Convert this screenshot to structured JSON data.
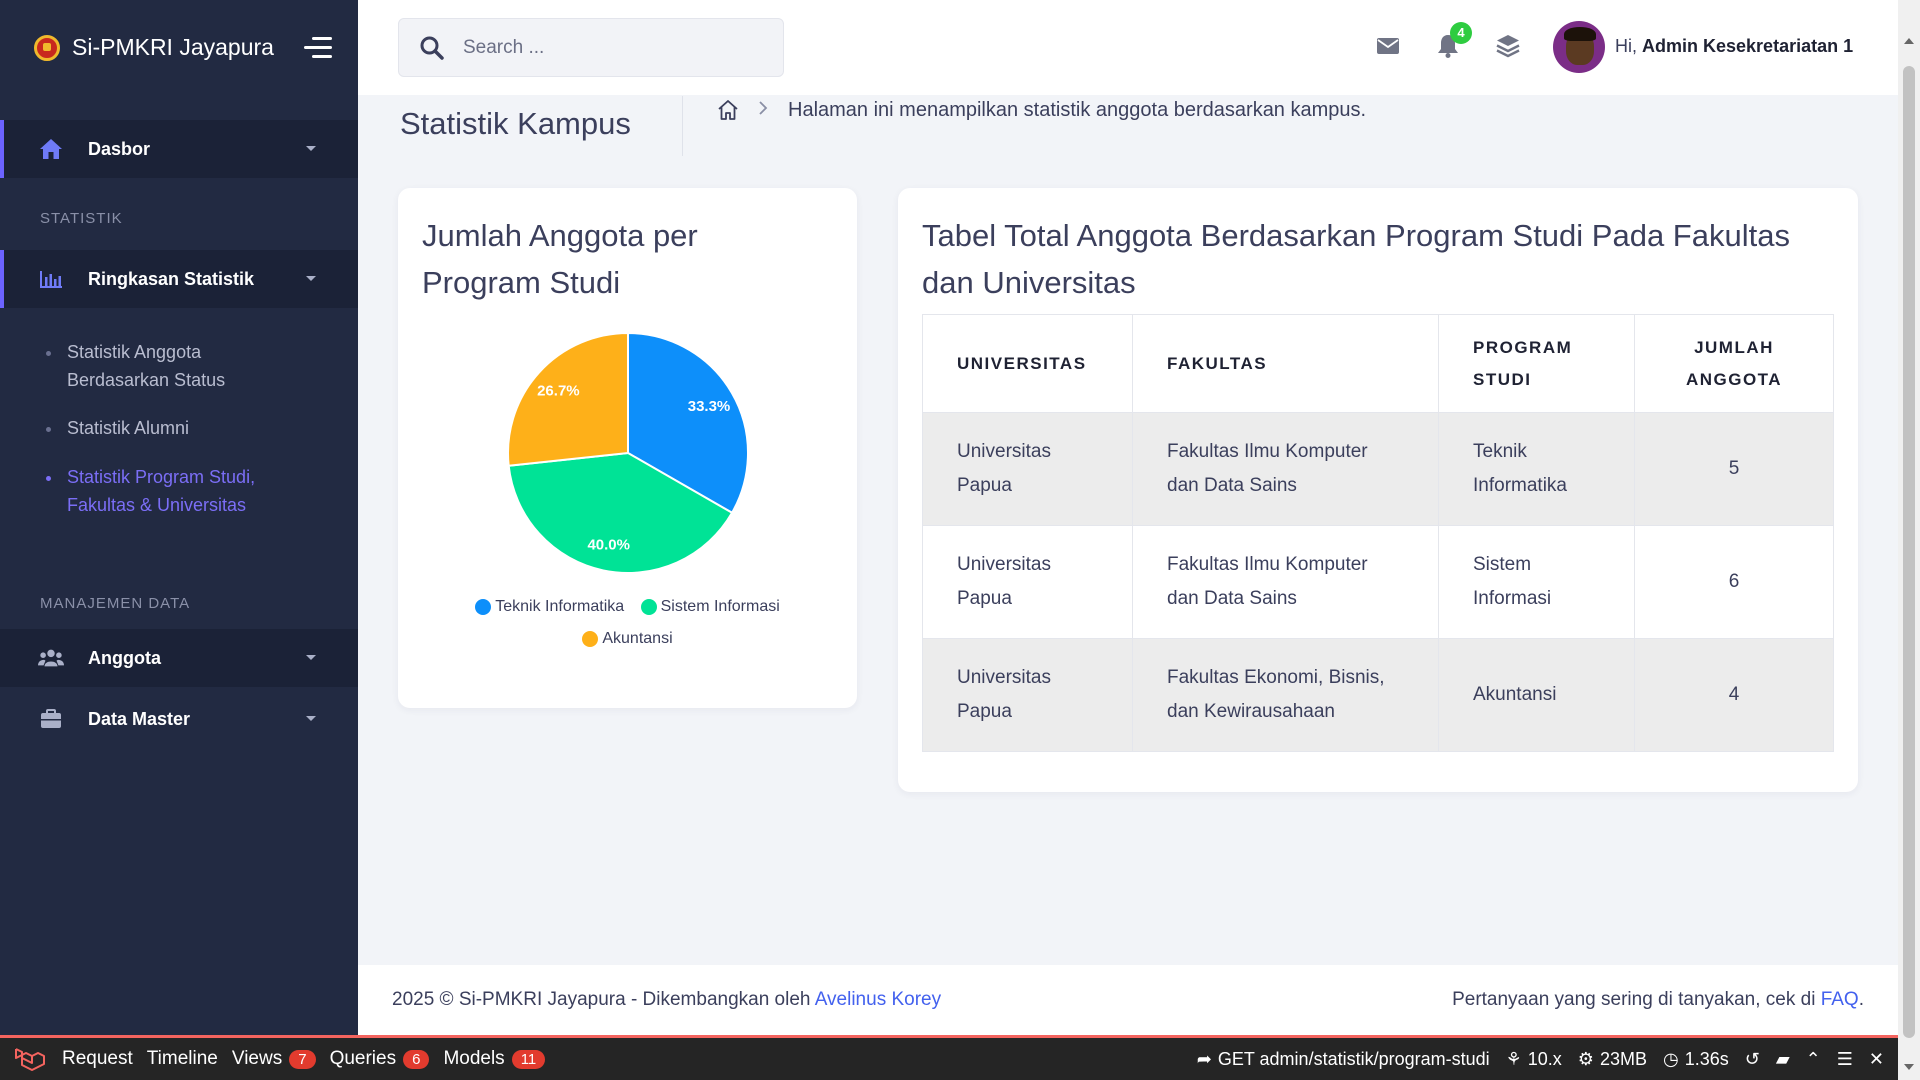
{
  "brand": {
    "name": "Si-PMKRI Jayapura"
  },
  "sidebar": {
    "dashboard": "Dasbor",
    "section_stats": "STATISTIK",
    "stats_menu": "Ringkasan Statistik",
    "sub_items": [
      {
        "label": "Statistik Anggota Berdasarkan Status"
      },
      {
        "label": "Statistik Alumni"
      },
      {
        "label": "Statistik Program Studi, Fakultas & Universitas"
      }
    ],
    "section_data": "MANAJEMEN DATA",
    "members": "Anggota",
    "master": "Data Master"
  },
  "header": {
    "search_placeholder": "Search ...",
    "notification_count": "4",
    "greeting_prefix": "Hi,",
    "user_name": "Admin Kesekretariatan 1"
  },
  "page": {
    "title": "Statistik Kampus",
    "description": "Halaman ini menampilkan statistik anggota berdasarkan kampus."
  },
  "pie_card": {
    "title": "Jumlah Anggota per Program Studi"
  },
  "chart_data": {
    "type": "pie",
    "title": "Jumlah Anggota per Program Studi",
    "categories": [
      "Teknik Informatika",
      "Sistem Informasi",
      "Akuntansi"
    ],
    "values": [
      33.3,
      40.0,
      26.7
    ],
    "labels": [
      "33.3%",
      "40.0%",
      "26.7%"
    ],
    "colors": [
      "#0d8ffa",
      "#00e396",
      "#feb019"
    ],
    "legend": "bottom"
  },
  "table_card": {
    "title": "Tabel Total Anggota Berdasarkan Program Studi Pada Fakultas dan Universitas",
    "headers": [
      "UNIVERSITAS",
      "FAKULTAS",
      "PROGRAM STUDI",
      "JUMLAH ANGGOTA"
    ],
    "rows": [
      [
        "Universitas Papua",
        "Fakultas Ilmu Komputer dan Data Sains",
        "Teknik Informatika",
        "5"
      ],
      [
        "Universitas Papua",
        "Fakultas Ilmu Komputer dan Data Sains",
        "Sistem Informasi",
        "6"
      ],
      [
        "Universitas Papua",
        "Fakultas Ekonomi, Bisnis, dan Kewirausahaan",
        "Akuntansi",
        "4"
      ]
    ]
  },
  "footer": {
    "left": "2025 © Si-PMKRI Jayapura - Dikembangkan oleh",
    "left_link": "Avelinus Korey",
    "right": "Pertanyaan yang sering di tanyakan, cek di",
    "right_link": "FAQ",
    "right_end": "."
  },
  "debugbar": {
    "tabs": [
      {
        "label": "Request"
      },
      {
        "label": "Timeline"
      },
      {
        "label": "Views",
        "count": "7"
      },
      {
        "label": "Queries",
        "count": "6"
      },
      {
        "label": "Models",
        "count": "11"
      }
    ],
    "route": "GET admin/statistik/program-studi",
    "version": "10.x",
    "memory": "23MB",
    "time": "1.36s"
  }
}
